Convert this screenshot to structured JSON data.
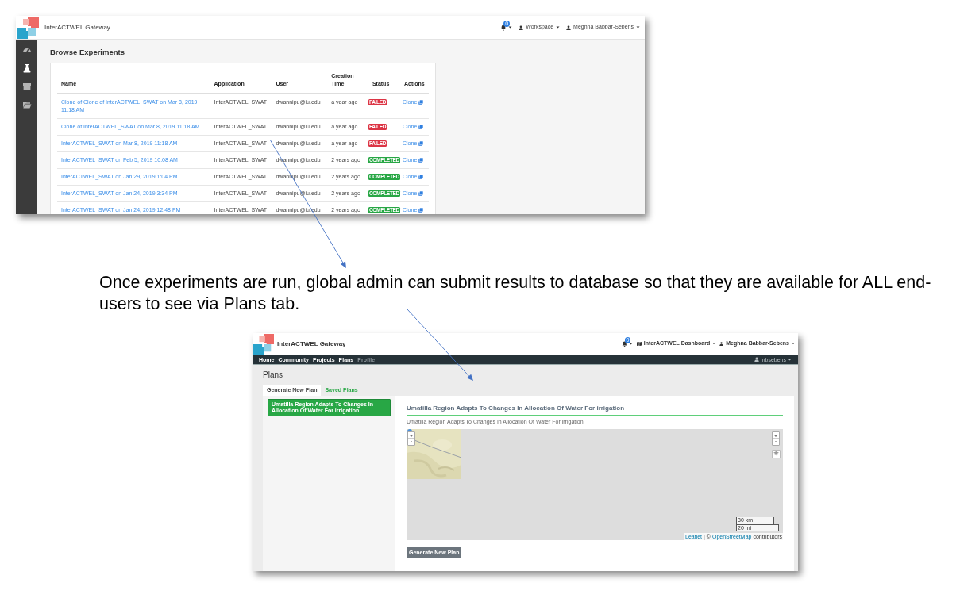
{
  "experiments_window": {
    "brand": "InterACTWEL Gateway",
    "notification_count": "0",
    "menus": [
      "Workspace",
      "Meghna Babbar-Sebens"
    ],
    "sidebar": [
      {
        "kind": "gauge",
        "selected": false
      },
      {
        "kind": "flask",
        "selected": true
      },
      {
        "kind": "box",
        "selected": false
      },
      {
        "kind": "folder",
        "selected": false
      }
    ],
    "page_title": "Browse Experiments",
    "table": {
      "columns": [
        "Name",
        "Application",
        "User",
        "Creation Time",
        "Status",
        "Actions"
      ],
      "rows": [
        {
          "name": "Clone of Clone of InterACTWEL_SWAT on Mar 8, 2019 11:18 AM",
          "application": "InterACTWEL_SWAT",
          "user": "dwannipu@iu.edu",
          "creation_time": "a year ago",
          "status": "FAILED",
          "color": "#dc3545",
          "action": "Clone"
        },
        {
          "name": "Clone of InterACTWEL_SWAT on Mar 8, 2019 11:18 AM",
          "application": "InterACTWEL_SWAT",
          "user": "dwannipu@iu.edu",
          "creation_time": "a year ago",
          "status": "FAILED",
          "color": "#dc3545",
          "action": "Clone"
        },
        {
          "name": "InterACTWEL_SWAT on Mar 8, 2019 11:18 AM",
          "application": "InterACTWEL_SWAT",
          "user": "dwannipu@iu.edu",
          "creation_time": "a year ago",
          "status": "FAILED",
          "color": "#dc3545",
          "action": "Clone"
        },
        {
          "name": "InterACTWEL_SWAT on Feb 5, 2019 10:08 AM",
          "application": "InterACTWEL_SWAT",
          "user": "dwannipu@iu.edu",
          "creation_time": "2 years ago",
          "status": "COMPLETED",
          "color": "#28a745",
          "action": "Clone"
        },
        {
          "name": "InterACTWEL_SWAT on Jan 29, 2019 1:04 PM",
          "application": "InterACTWEL_SWAT",
          "user": "dwannipu@iu.edu",
          "creation_time": "2 years ago",
          "status": "COMPLETED",
          "color": "#28a745",
          "action": "Clone"
        },
        {
          "name": "InterACTWEL_SWAT on Jan 24, 2019 3:34 PM",
          "application": "InterACTWEL_SWAT",
          "user": "dwannipu@iu.edu",
          "creation_time": "2 years ago",
          "status": "COMPLETED",
          "color": "#28a745",
          "action": "Clone"
        },
        {
          "name": "InterACTWEL_SWAT on Jan 24, 2019 12:48 PM",
          "application": "InterACTWEL_SWAT",
          "user": "dwannipu@iu.edu",
          "creation_time": "2 years ago",
          "status": "COMPLETED",
          "color": "#28a745",
          "action": "Clone"
        }
      ]
    }
  },
  "caption": "Once experiments are run, global admin can submit results to database so that they are available for ALL end-users to see via Plans tab.",
  "plans_window": {
    "brand": "InterACTWEL Gateway",
    "notification_count": "0",
    "menus": [
      "InterACTWEL Dashboard",
      "Meghna Babbar-Sebens"
    ],
    "nav": [
      {
        "label": "Home",
        "disabled": false
      },
      {
        "label": "Community",
        "disabled": false
      },
      {
        "label": "Projects",
        "disabled": false
      },
      {
        "label": "Plans",
        "disabled": false
      },
      {
        "label": "Profile",
        "disabled": true
      }
    ],
    "nav_user": "mbsebens",
    "page_title": "Plans",
    "tabs": [
      {
        "label": "Generate New Plan",
        "selected": true
      },
      {
        "label": "Saved Plans",
        "selected": false
      }
    ],
    "plans": [
      {
        "label": "Umatilla Region Adapts To Changes In Allocation Of Water For irrigation",
        "selected": true
      }
    ],
    "plan_title": "Umatilla Region Adapts To Changes In Allocation Of Water For irrigation",
    "plan_subtitle": "Umatilla Region Adapts To Changes In Allocation Of Water For irrigation",
    "map": {
      "zoom_in": "+",
      "zoom_out": "-",
      "scale": [
        "30 km",
        "20 mi"
      ],
      "attribution": {
        "library": "Leaflet",
        "separator": "| ©",
        "source": "OpenStreetMap",
        "suffix": "contributors"
      }
    },
    "button": "Generate New Plan"
  }
}
